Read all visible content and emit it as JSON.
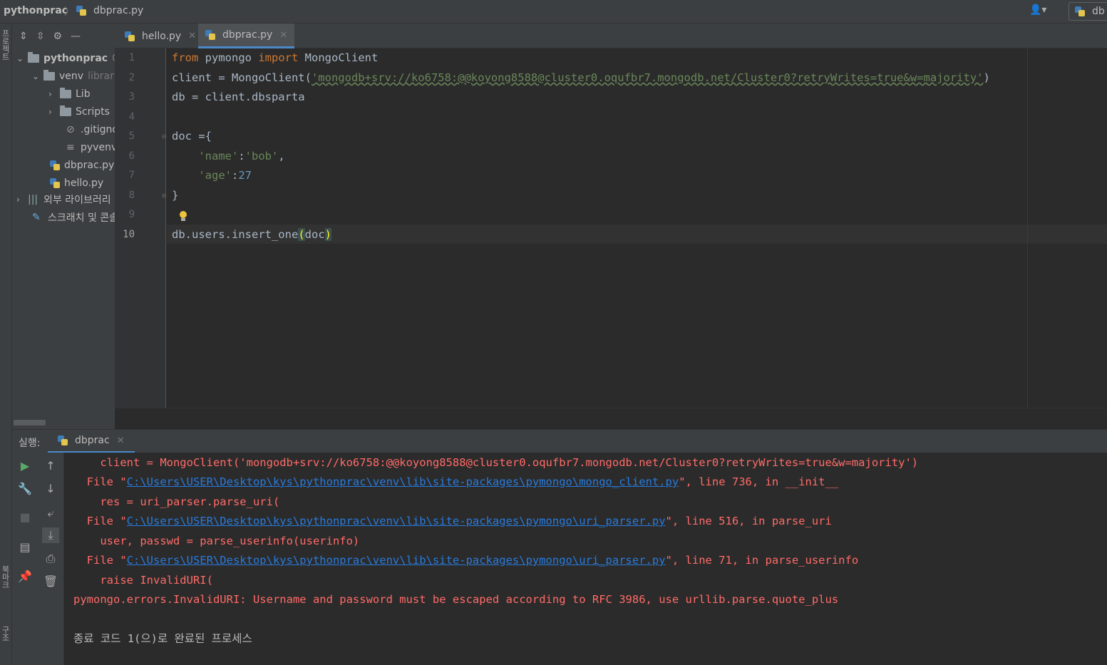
{
  "navbar": {
    "project": "pythonprac",
    "file": "dbprac.py",
    "run_config": "db"
  },
  "left_strip": {
    "top_label": "프로젝트",
    "mid_label": "북마크",
    "bottom_label": "구조"
  },
  "project_tree": {
    "items": [
      {
        "label": "pythonprac",
        "suffix": "C:"
      },
      {
        "label": "venv",
        "suffix": "library"
      },
      {
        "label": "Lib"
      },
      {
        "label": "Scripts"
      },
      {
        "label": ".gitignore"
      },
      {
        "label": "pyvenv.cfg"
      },
      {
        "label": "dbprac.py"
      },
      {
        "label": "hello.py"
      },
      {
        "label": "외부 라이브러리"
      },
      {
        "label": "스크래치 및 콘솔"
      }
    ]
  },
  "tabs": [
    {
      "label": "hello.py"
    },
    {
      "label": "dbprac.py"
    }
  ],
  "editor": {
    "line_numbers": [
      "1",
      "2",
      "3",
      "4",
      "5",
      "6",
      "7",
      "8",
      "9",
      "10"
    ],
    "line1": {
      "kw_from": "from",
      "mod": " pymongo ",
      "kw_import": "import",
      "rest": " MongoClient"
    },
    "line2": {
      "pre": "client = MongoClient(",
      "str": "'mongodb+srv://ko6758:@@koyong8588@cluster0.oqufbr7.mongodb.net/Cluster0?retryWrites=true&w=majority'",
      "post": ")"
    },
    "line3": "db = client.dbsparta",
    "line5": "doc ={",
    "line6": {
      "key": "'name'",
      "colon": ":",
      "val": "'bob'",
      "comma": ","
    },
    "line7": {
      "key": "'age'",
      "colon": ":",
      "val": "27"
    },
    "line8": "}",
    "line10": {
      "pre": "db.users.insert_one",
      "open": "(",
      "arg": "doc",
      "close": ")"
    }
  },
  "run_panel": {
    "label": "실행:",
    "tab": "dbprac"
  },
  "console": {
    "lines": [
      {
        "text": "    client = MongoClient('mongodb+srv://ko6758:@@koyong8588@cluster0.oqufbr7.mongodb.net/Cluster0?retryWrites=true&w=majority')"
      },
      {
        "pre": "  File \"",
        "link": "C:\\Users\\USER\\Desktop\\kys\\pythonprac\\venv\\lib\\site-packages\\pymongo\\mongo_client.py",
        "post": "\", line 736, in __init__"
      },
      {
        "text": "    res = uri_parser.parse_uri("
      },
      {
        "pre": "  File \"",
        "link": "C:\\Users\\USER\\Desktop\\kys\\pythonprac\\venv\\lib\\site-packages\\pymongo\\uri_parser.py",
        "post": "\", line 516, in parse_uri"
      },
      {
        "text": "    user, passwd = parse_userinfo(userinfo)"
      },
      {
        "pre": "  File \"",
        "link": "C:\\Users\\USER\\Desktop\\kys\\pythonprac\\venv\\lib\\site-packages\\pymongo\\uri_parser.py",
        "post": "\", line 71, in parse_userinfo"
      },
      {
        "text": "    raise InvalidURI("
      },
      {
        "text": "pymongo.errors.InvalidURI: Username and password must be escaped according to RFC 3986, use urllib.parse.quote_plus"
      },
      {
        "text": "종료 코드 1(으)로 완료된 프로세스"
      }
    ]
  }
}
